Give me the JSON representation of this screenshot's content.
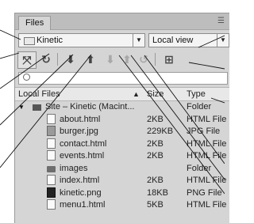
{
  "panel": {
    "tab_label": "Files",
    "menu_icon": "panel-menu-icon"
  },
  "site_select": {
    "value": "Kinetic"
  },
  "view_select": {
    "value": "Local view"
  },
  "toolbar": {
    "buttons": [
      {
        "name": "connect-button",
        "glyph": "⤧"
      },
      {
        "name": "refresh-button",
        "glyph": "↻"
      },
      {
        "name": "get-files-button",
        "glyph": "⬇"
      },
      {
        "name": "put-files-button",
        "glyph": "⬆"
      },
      {
        "name": "check-out-button",
        "glyph": "⬇"
      },
      {
        "name": "check-in-button",
        "glyph": "⬆"
      },
      {
        "name": "synchronize-button",
        "glyph": "↺"
      },
      {
        "name": "expand-button",
        "glyph": "⊞"
      }
    ]
  },
  "file_list": {
    "columns": {
      "name": "Local Files",
      "size": "Size",
      "type": "Type"
    },
    "rows": [
      {
        "name": "Site – Kinetic (Macint...",
        "size": "",
        "type": "Folder",
        "kind": "site"
      },
      {
        "name": "about.html",
        "size": "2KB",
        "type": "HTML File",
        "kind": "html"
      },
      {
        "name": "burger.jpg",
        "size": "229KB",
        "type": "JPG File",
        "kind": "img"
      },
      {
        "name": "contact.html",
        "size": "2KB",
        "type": "HTML File",
        "kind": "html"
      },
      {
        "name": "events.html",
        "size": "2KB",
        "type": "HTML File",
        "kind": "html"
      },
      {
        "name": "images",
        "size": "",
        "type": "Folder",
        "kind": "folder"
      },
      {
        "name": "index.html",
        "size": "2KB",
        "type": "HTML File",
        "kind": "html"
      },
      {
        "name": "kinetic.png",
        "size": "18KB",
        "type": "PNG File",
        "kind": "png"
      },
      {
        "name": "menu1.html",
        "size": "5KB",
        "type": "HTML File",
        "kind": "html"
      }
    ]
  }
}
